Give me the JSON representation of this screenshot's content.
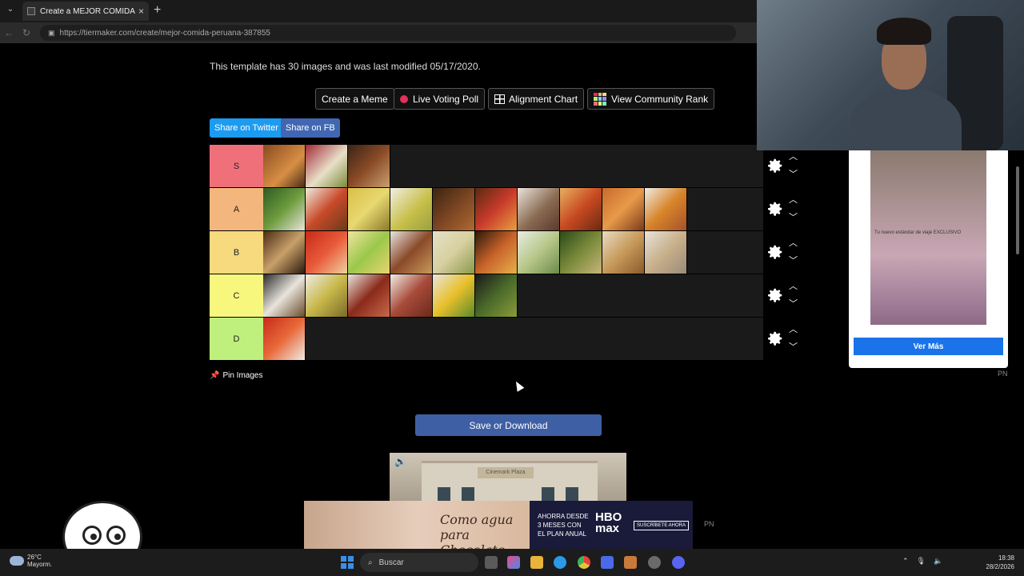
{
  "browser": {
    "tab_title": "Create a MEJOR COMIDA PERUANA",
    "tab_close": "×",
    "new_tab": "+",
    "url": "https://tiermaker.com/create/mejor-comida-peruana-387855"
  },
  "page": {
    "info": "This template has 30 images and was last modified 05/17/2020.",
    "buttons": {
      "create_meme": "Create a Meme",
      "live_voting": "Live Voting Poll",
      "alignment_chart": "Alignment Chart",
      "community_rank": "View Community Rank"
    },
    "share": {
      "twitter": "Share on Twitter",
      "facebook": "Share on FB"
    },
    "tiers": [
      {
        "label": "S",
        "color": "#f0707a",
        "items": 3
      },
      {
        "label": "A",
        "color": "#f3b67c",
        "items": 10
      },
      {
        "label": "B",
        "color": "#f7d97e",
        "items": 10
      },
      {
        "label": "C",
        "color": "#f7f77e",
        "items": 6
      },
      {
        "label": "D",
        "color": "#bff07e",
        "items": 1
      }
    ],
    "pin_images": "Pin Images",
    "save_download": "Save or Download"
  },
  "ads": {
    "side_caption": "Tu nuevo estándar de viaje EXCLUSIVO",
    "side_button": "Ver Más",
    "side_pn": "PN",
    "bottom_script": "Como agua para Chocolate",
    "bottom_promo": "AHORRA DESDE 3 MESES CON EL PLAN ANUAL",
    "bottom_brand": "HBO max",
    "bottom_cta": "SUSCRÍBETE AHORA",
    "bottom_pn": "PN",
    "video_sign": "Cinemark Plaza"
  },
  "taskbar": {
    "temp": "26°C",
    "weather_label": "Mayorm.",
    "search": "Buscar",
    "time": "18:38",
    "date": "28/2/2026"
  },
  "colors": {
    "twitter": "#1d9bf0",
    "facebook": "#4267b2",
    "save": "#3f5fa5",
    "ver_mas": "#1a73e8"
  }
}
